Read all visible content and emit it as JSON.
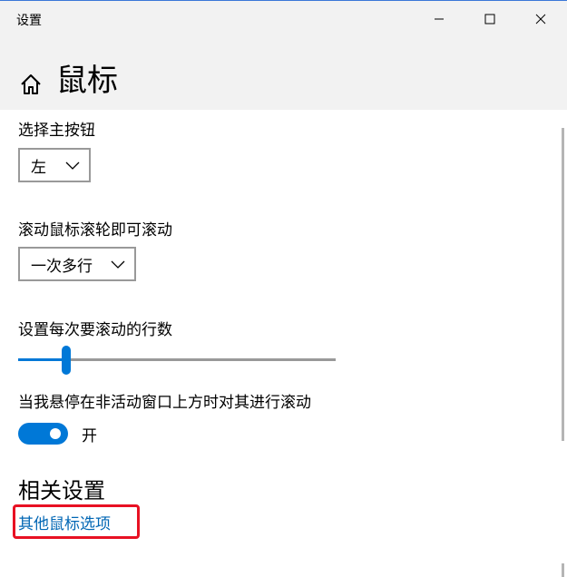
{
  "window": {
    "app_title": "设置"
  },
  "header": {
    "page_title": "鼠标"
  },
  "settings": {
    "primary_button": {
      "label": "选择主按钮",
      "value": "左"
    },
    "wheel_scroll": {
      "label": "滚动鼠标滚轮即可滚动",
      "value": "一次多行"
    },
    "lines_per_scroll": {
      "label": "设置每次要滚动的行数",
      "value_fraction": 0.15
    },
    "inactive_scroll": {
      "label": "当我悬停在非活动窗口上方时对其进行滚动",
      "state": "开",
      "on": true
    }
  },
  "related": {
    "title": "相关设置",
    "link_label": "其他鼠标选项"
  },
  "colors": {
    "accent": "#0078d7",
    "link": "#0066b4",
    "highlight": "#e81123"
  },
  "icons": {
    "home": "home-icon",
    "minimize": "minimize-icon",
    "maximize": "maximize-icon",
    "close": "close-icon",
    "dropdown": "chevron-down-icon"
  }
}
